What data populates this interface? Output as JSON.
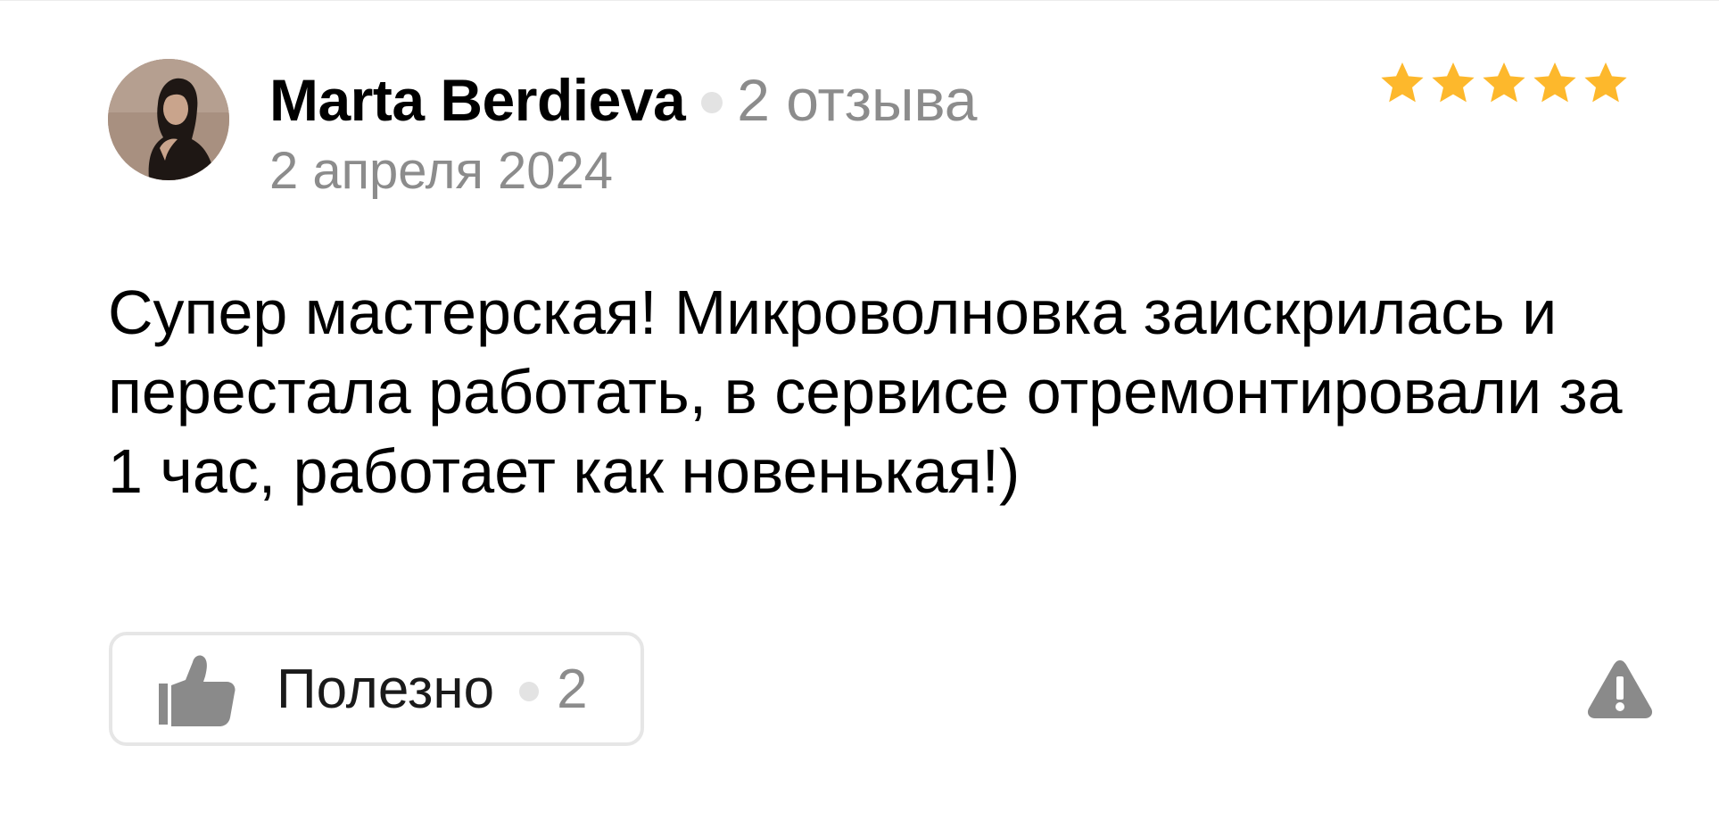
{
  "review": {
    "author": {
      "name": "Marta Berdieva",
      "review_count": "2 отзыва",
      "avatar_icon": "user-photo"
    },
    "date": "2 апреля 2024",
    "rating": {
      "value": 5,
      "max": 5,
      "color": "#fdb82c",
      "icon": "star-icon"
    },
    "text": "Супер мастерская! Микроволновка заискрилась и перестала работать, в сервисе отремонтировали за 1 час, работает как новенькая!)",
    "actions": {
      "helpful_label": "Полезно",
      "helpful_count": "2",
      "helpful_icon": "thumbs-up-icon",
      "report_icon": "warning-triangle-icon"
    }
  },
  "colors": {
    "text": "#000000",
    "muted": "#8c8c8c",
    "separator": "#e3e3e3",
    "icon_gray": "#8a8a8a",
    "border": "#e6e6e6"
  }
}
